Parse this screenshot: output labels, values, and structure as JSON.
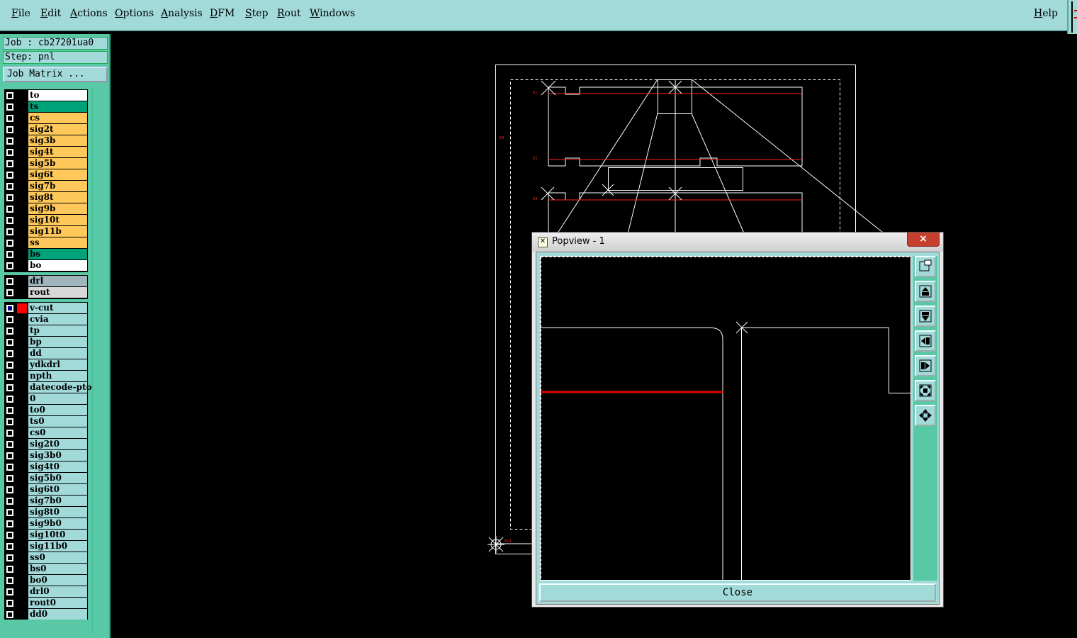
{
  "menu": {
    "items": [
      "File",
      "Edit",
      "Actions",
      "Options",
      "Analysis",
      "DFM",
      "Step",
      "Rout",
      "Windows"
    ],
    "help": "Help"
  },
  "job": {
    "label": "Job : cb27201ua0",
    "step": "Step: pnl",
    "matrix_button": "Job Matrix ..."
  },
  "layers": {
    "board": [
      {
        "name": "to",
        "color": "#ffffff"
      },
      {
        "name": "ts",
        "color": "#00a27a"
      },
      {
        "name": "cs",
        "color": "#ffc85a"
      },
      {
        "name": "sig2t",
        "color": "#ffc85a"
      },
      {
        "name": "sig3b",
        "color": "#ffc85a"
      },
      {
        "name": "sig4t",
        "color": "#ffc85a"
      },
      {
        "name": "sig5b",
        "color": "#ffc85a"
      },
      {
        "name": "sig6t",
        "color": "#ffc85a"
      },
      {
        "name": "sig7b",
        "color": "#ffc85a"
      },
      {
        "name": "sig8t",
        "color": "#ffc85a"
      },
      {
        "name": "sig9b",
        "color": "#ffc85a"
      },
      {
        "name": "sig10t",
        "color": "#ffc85a"
      },
      {
        "name": "sig11b",
        "color": "#ffc85a"
      },
      {
        "name": "ss",
        "color": "#ffc85a"
      },
      {
        "name": "bs",
        "color": "#00a27a"
      },
      {
        "name": "bo",
        "color": "#ffffff"
      }
    ],
    "drill": [
      {
        "name": "drl",
        "color": "#9fb4bb"
      },
      {
        "name": "rout",
        "color": "#d8d8d8"
      }
    ],
    "misc": [
      {
        "name": "v-cut",
        "color": "#a2dada",
        "active": true
      },
      {
        "name": "cvia",
        "color": "#a2dada"
      },
      {
        "name": "tp",
        "color": "#a2dada"
      },
      {
        "name": "bp",
        "color": "#a2dada"
      },
      {
        "name": "dd",
        "color": "#a2dada"
      },
      {
        "name": "ydkdrl",
        "color": "#a2dada"
      },
      {
        "name": "npth",
        "color": "#a2dada"
      },
      {
        "name": "datecode-pto",
        "color": "#a2dada"
      },
      {
        "name": "0",
        "color": "#a2dada"
      },
      {
        "name": "to0",
        "color": "#a2dada"
      },
      {
        "name": "ts0",
        "color": "#a2dada"
      },
      {
        "name": "cs0",
        "color": "#a2dada"
      },
      {
        "name": "sig2t0",
        "color": "#a2dada"
      },
      {
        "name": "sig3b0",
        "color": "#a2dada"
      },
      {
        "name": "sig4t0",
        "color": "#a2dada"
      },
      {
        "name": "sig5b0",
        "color": "#a2dada"
      },
      {
        "name": "sig6t0",
        "color": "#a2dada"
      },
      {
        "name": "sig7b0",
        "color": "#a2dada"
      },
      {
        "name": "sig8t0",
        "color": "#a2dada"
      },
      {
        "name": "sig9b0",
        "color": "#a2dada"
      },
      {
        "name": "sig10t0",
        "color": "#a2dada"
      },
      {
        "name": "sig11b0",
        "color": "#a2dada"
      },
      {
        "name": "ss0",
        "color": "#a2dada"
      },
      {
        "name": "bs0",
        "color": "#a2dada"
      },
      {
        "name": "bo0",
        "color": "#a2dada"
      },
      {
        "name": "drl0",
        "color": "#a2dada"
      },
      {
        "name": "rout0",
        "color": "#a2dada"
      },
      {
        "name": "dd0",
        "color": "#a2dada"
      }
    ]
  },
  "popview": {
    "title": "Popview - 1",
    "close_x": "×",
    "close_button": "Close",
    "tools": [
      "zoom-window-icon",
      "zoom-in-icon",
      "zoom-out-icon",
      "pan-left-icon",
      "pan-right-icon",
      "fit-all-icon",
      "pan-center-icon"
    ]
  },
  "colors": {
    "accent": "#a2dada",
    "panel": "#59c9a5",
    "vcut": "#ff0000"
  }
}
